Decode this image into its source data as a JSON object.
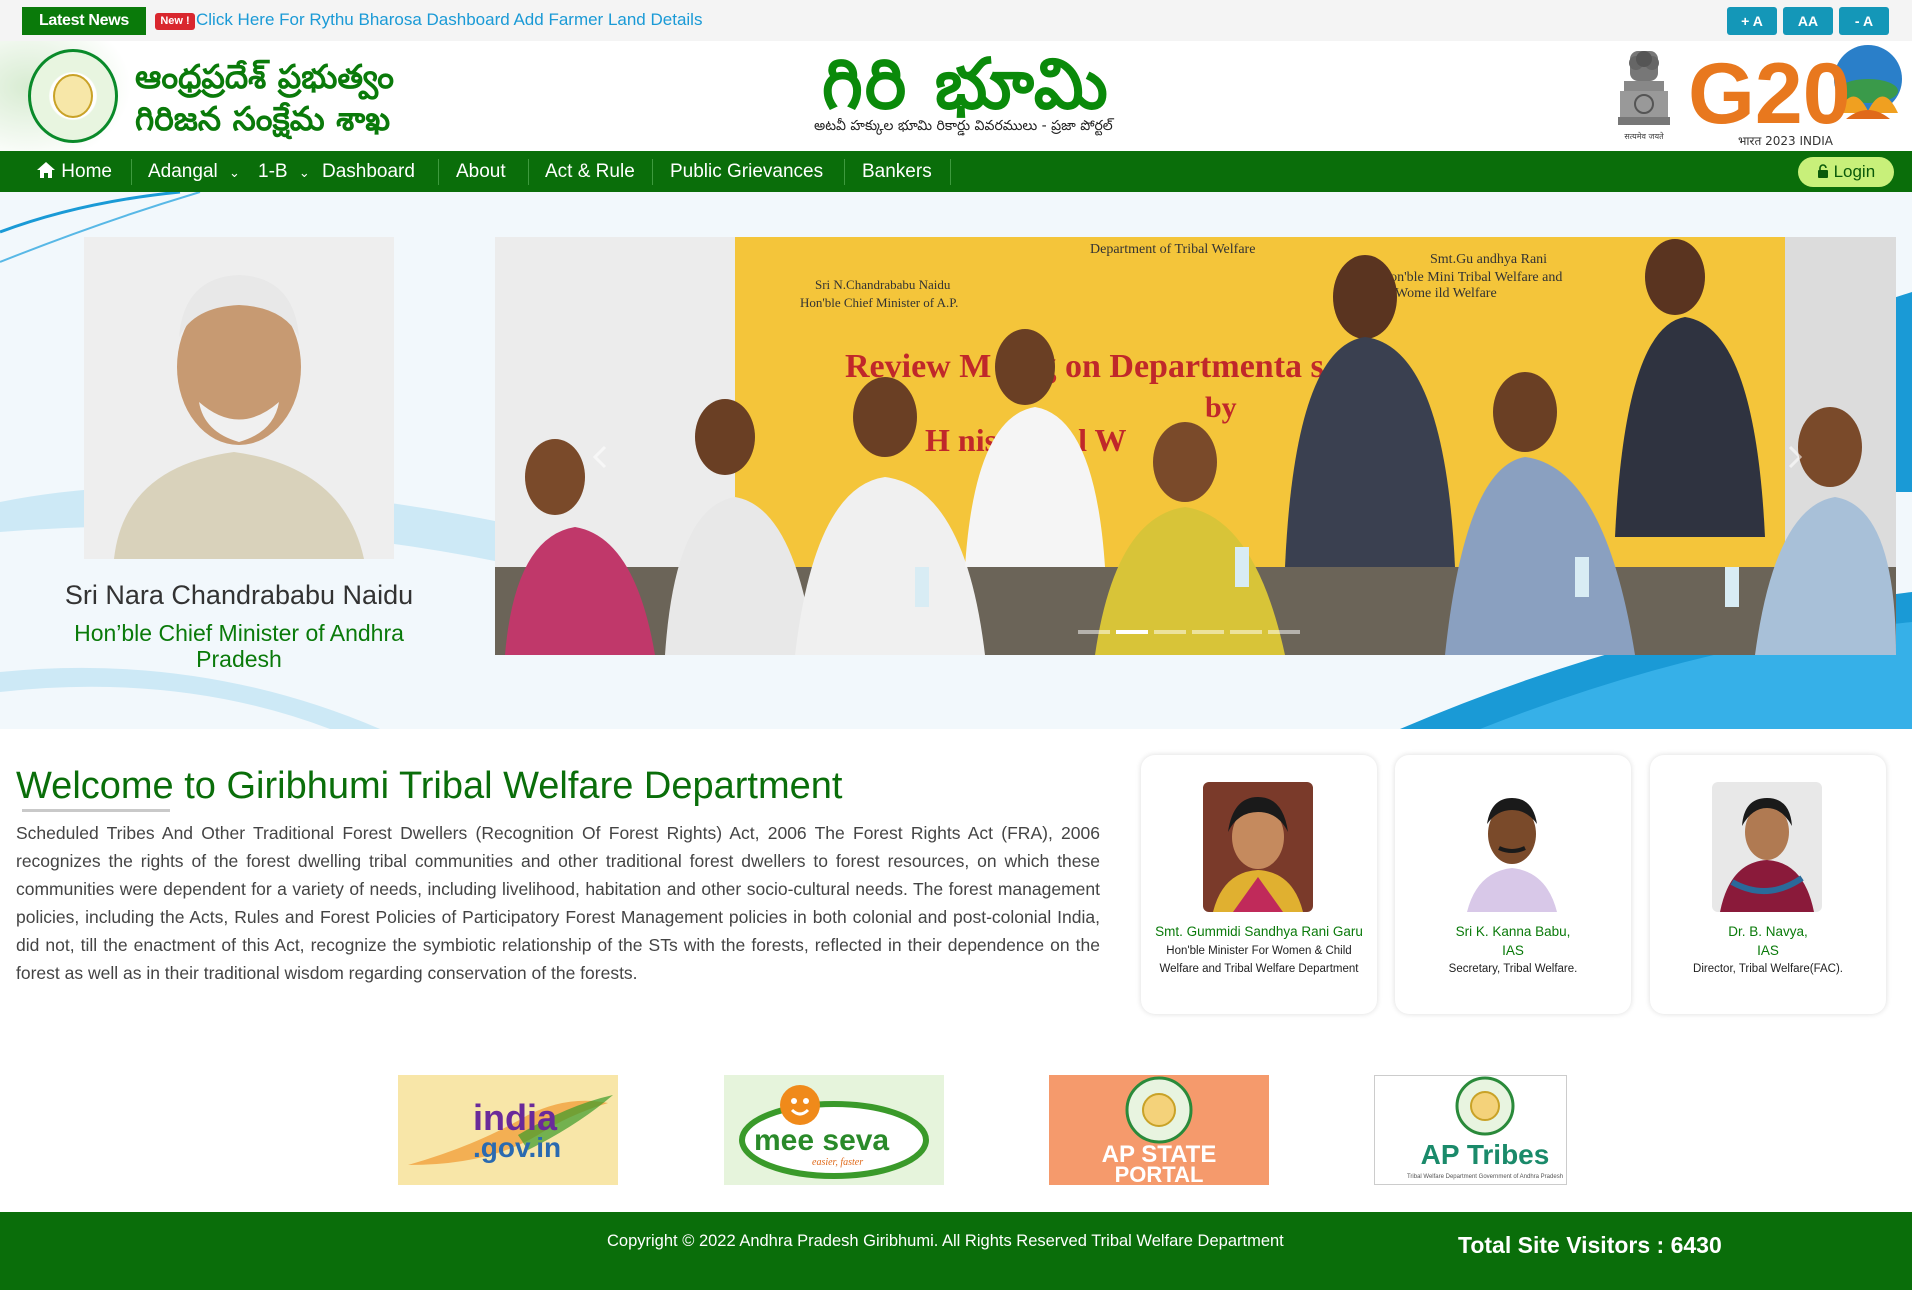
{
  "topbar": {
    "latest_label": "Latest News",
    "new_badge": "New !",
    "news_text": "Click Here For Rythu Bharosa Dashboard Add Farmer Land Details",
    "font_increase": "+ A",
    "font_default": "AA",
    "font_decrease": "- A"
  },
  "header": {
    "dept_line1": "ఆంధ్రప్రదేశ్ ప్రభుత్వం",
    "dept_line2": "గిరిజన సంక్షేమ శాఖ",
    "site_title": "గిరి భూమి",
    "site_subtitle": "అటవీ హక్కుల భూమి రికార్డు వివరములు - ప్రజా పోర్టల్",
    "emblem_motto": "सत्यमेव जयते",
    "g20_text": "G20",
    "g20_caption": "भारत 2023 INDIA"
  },
  "nav": {
    "items": [
      {
        "label": "Home",
        "icon": "home-icon"
      },
      {
        "label": "Adangal",
        "dropdown": true
      },
      {
        "label": "1-B",
        "dropdown": true
      },
      {
        "label": "Dashboard"
      },
      {
        "label": "About"
      },
      {
        "label": "Act & Rule"
      },
      {
        "label": "Public Grievances"
      },
      {
        "label": "Bankers"
      }
    ],
    "login_label": "Login"
  },
  "hero": {
    "cm_name": "Sri Nara Chandrababu Naidu",
    "cm_title": "Hon’ble Chief Minister of Andhra Pradesh",
    "slide": {
      "banner_dept": "Department of Tribal Welfare",
      "banner_cm_name": "Sri N.Chandrababu Naidu",
      "banner_cm_title": "Hon'ble Chief Minister of A.P.",
      "banner_minister_name": "Smt.Gu          andhya Rani",
      "banner_minister_title1": "Hon'ble Mini         Tribal Welfare and",
      "banner_minister_title2": "Wome         ild Welfare",
      "banner_headline1": "Review M    ting on Departmenta       s",
      "banner_headline2": "by",
      "banner_headline3": "H           nister fo       l W"
    },
    "slide_count": 6,
    "active_slide": 2
  },
  "welcome": {
    "title": "Welcome to Giribhumi Tribal Welfare Department",
    "body": "Scheduled Tribes And Other Traditional Forest Dwellers (Recognition Of Forest Rights) Act, 2006 The Forest Rights Act (FRA), 2006 recognizes the rights of the forest dwelling tribal communities and other traditional forest dwellers to forest resources, on which these communities were dependent for a variety of needs, including livelihood, habitation and other socio-cultural needs. The forest management policies, including the Acts, Rules and Forest Policies of Participatory Forest Management policies in both colonial and post-colonial India, did not, till the enactment of this Act, recognize the symbiotic relationship of the STs with the forests, reflected in their dependence on the forest as well as in their traditional wisdom regarding conservation of the forests."
  },
  "officials": [
    {
      "name": "Smt. Gummidi Sandhya Rani Garu",
      "role1": "Hon'ble Minister For Women & Child",
      "role2": "Welfare and Tribal Welfare Department"
    },
    {
      "name": "Sri K. Kanna Babu,",
      "name2": "IAS",
      "role1": "Secretary, Tribal Welfare."
    },
    {
      "name": "Dr. B. Navya,",
      "name2": "IAS",
      "role1": "Director, Tribal Welfare(FAC)."
    }
  ],
  "partners": [
    {
      "name": "india-gov-logo",
      "line1": "india",
      "line2": ".gov.in"
    },
    {
      "name": "mee-seva-logo",
      "line1": "mee seva",
      "tagline": "easier, faster"
    },
    {
      "name": "ap-state-portal-logo",
      "line1": "AP STATE",
      "line2": "PORTAL"
    },
    {
      "name": "ap-tribes-logo",
      "line1": "AP Tribes",
      "tagline": "Tribal Welfare Department Government of Andhra Pradesh"
    }
  ],
  "footer": {
    "copyright": "Copyright © 2022 Andhra Pradesh Giribhumi. All Rights Reserved Tribal Welfare Department",
    "visitors": "Total Site Visitors : 6430"
  },
  "colors": {
    "brand_green": "#0a6e0a",
    "accent_blue": "#1497b8",
    "news_link": "#1a9ad6",
    "login_bg": "#c8f07a"
  }
}
